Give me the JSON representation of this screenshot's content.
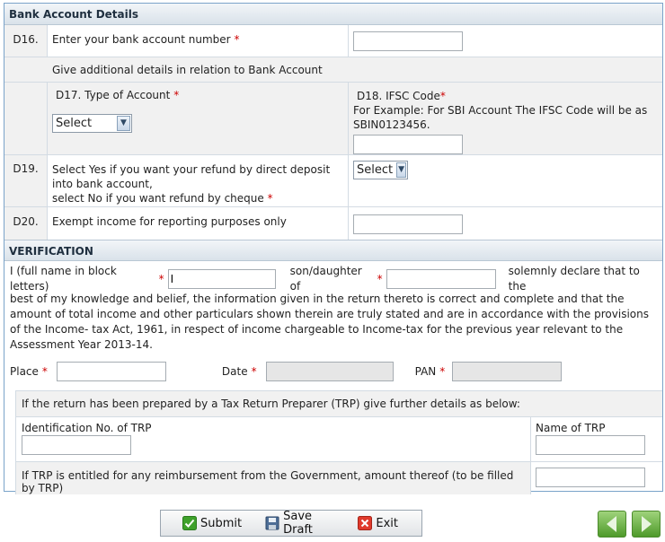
{
  "bank": {
    "header": "Bank Account Details",
    "d16": {
      "code": "D16.",
      "label": "Enter your bank account number",
      "value": ""
    },
    "additional": "Give additional details in relation to Bank Account",
    "d17": {
      "label": "D17. Type of Account",
      "selected": "Select"
    },
    "d18": {
      "label": "D18. IFSC Code",
      "example": "For Example: For SBI Account The IFSC Code will be as SBIN0123456.",
      "value": ""
    },
    "d19": {
      "code": "D19.",
      "line1": "Select Yes if you want your refund by direct deposit into bank account,",
      "line2": "select No if you want refund by cheque",
      "selected": "Select"
    },
    "d20": {
      "code": "D20.",
      "label": "Exempt income for reporting purposes only",
      "value": ""
    }
  },
  "verification": {
    "header": "VERIFICATION",
    "i_label": "I (full name in block letters)",
    "name_value": "I",
    "son_label": "son/daughter of",
    "declare_tail": "solemnly declare that to the",
    "declaration": "best of my knowledge and belief, the information given in the return thereto is correct and complete and that the amount of total income and other particulars shown therein are truly stated and are in accordance with the provisions of the Income- tax Act, 1961, in respect of income chargeable to Income-tax for the previous year relevant to the Assessment Year 2013-14.",
    "place_label": "Place",
    "date_label": "Date",
    "pan_label": "PAN",
    "trp_intro": "If the return has been prepared by a Tax Return Preparer (TRP) give further details as below:",
    "trp_id_label": "Identification No. of TRP",
    "trp_name_label": "Name of TRP",
    "trp_reimb_label": "If TRP is entitled for any reimbursement from the Government, amount thereof (to be filled by TRP)"
  },
  "actions": {
    "submit": "Submit",
    "save_draft": "Save Draft",
    "exit": "Exit"
  },
  "required_mark": "*",
  "colors": {
    "accent": "#7aa3c9",
    "nav_green": "#4e9a2a",
    "required": "#cc0000"
  }
}
